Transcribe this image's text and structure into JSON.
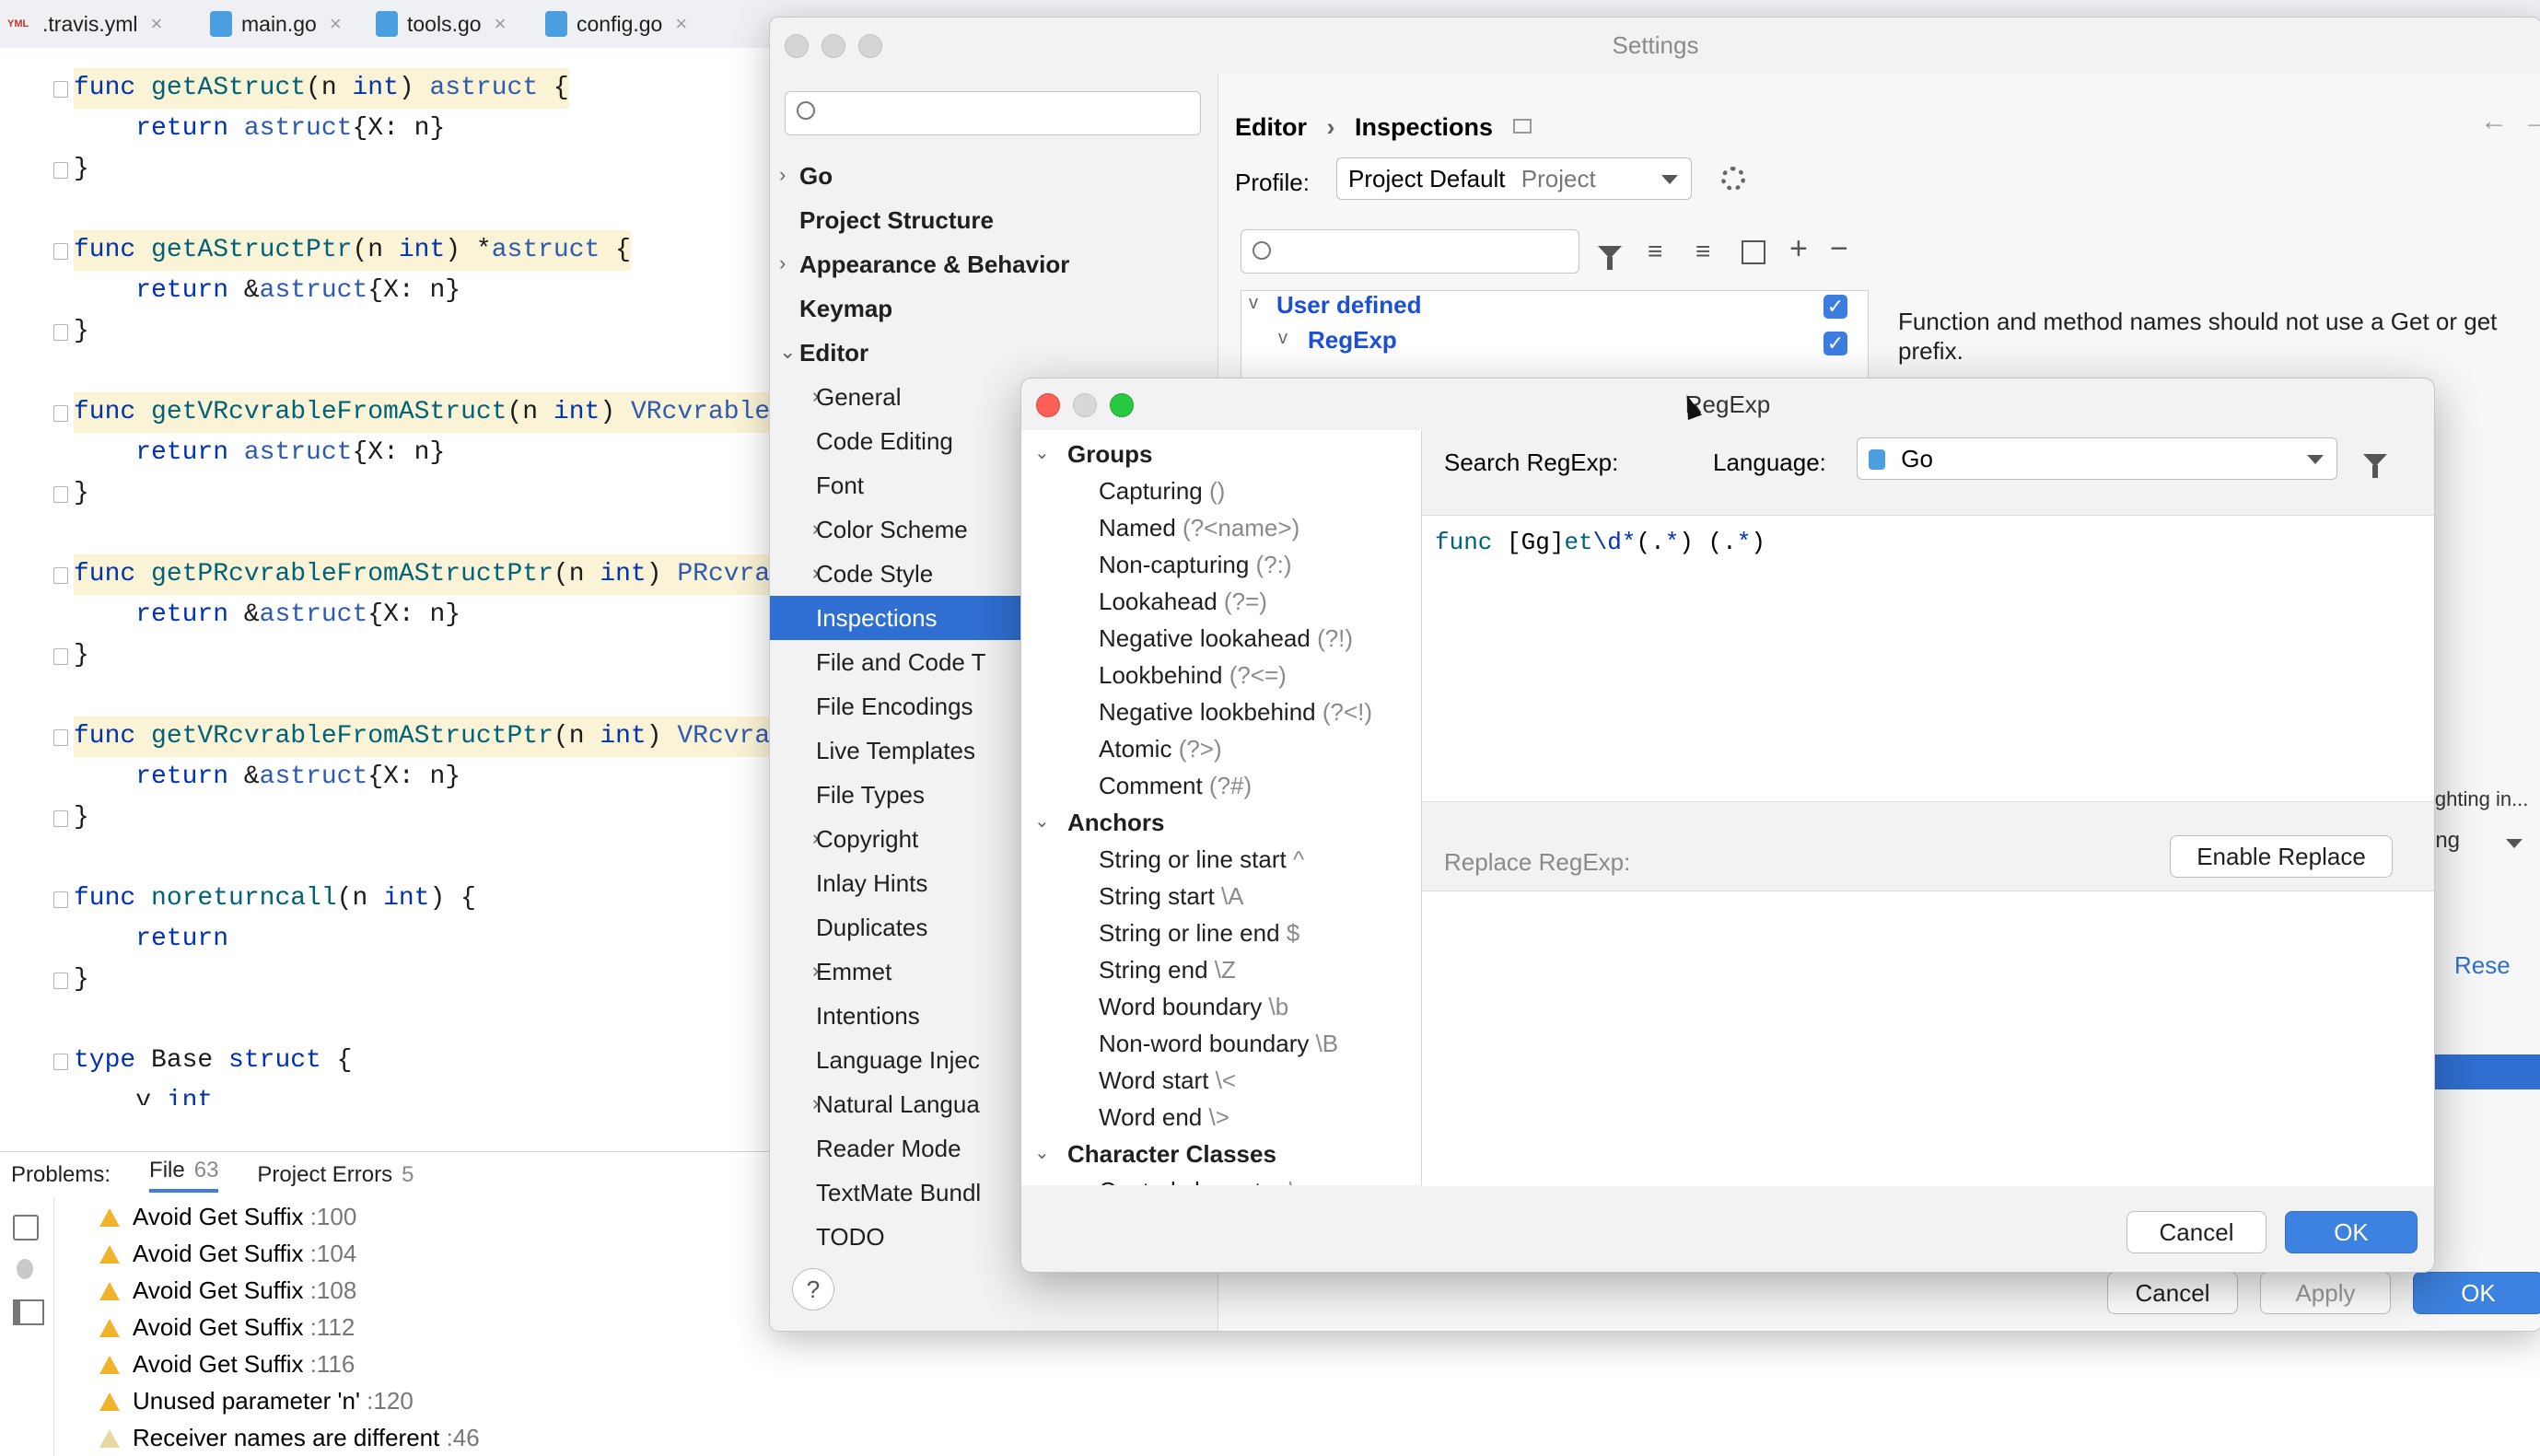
{
  "tabs": [
    {
      "label": ".travis.yml",
      "icon": "yml-file-icon"
    },
    {
      "label": "main.go",
      "icon": "go-file-icon"
    },
    {
      "label": "tools.go",
      "icon": "go-file-icon"
    },
    {
      "label": "config.go",
      "icon": "go-file-icon"
    }
  ],
  "editor": {
    "lines": [
      {
        "parts": [
          [
            "kw",
            "func "
          ],
          [
            "fn",
            "getAStruct"
          ],
          [
            "",
            "(n "
          ],
          [
            "kw",
            "int"
          ],
          [
            "",
            ") "
          ],
          [
            "ty",
            "astruct"
          ],
          [
            "",
            " {"
          ]
        ],
        "hl": true
      },
      {
        "parts": [
          [
            "",
            "    "
          ],
          [
            "kw",
            "return "
          ],
          [
            "ty",
            "astruct"
          ],
          [
            "",
            "{X: n}"
          ]
        ],
        "hl": false
      },
      {
        "parts": [
          [
            "",
            "}"
          ]
        ],
        "hl": false
      },
      {
        "parts": [
          [
            "",
            ""
          ]
        ],
        "hl": false
      },
      {
        "parts": [
          [
            "kw",
            "func "
          ],
          [
            "fn",
            "getAStructPtr"
          ],
          [
            "",
            "(n "
          ],
          [
            "kw",
            "int"
          ],
          [
            "",
            ") *"
          ],
          [
            "ty",
            "astruct"
          ],
          [
            "",
            " {"
          ]
        ],
        "hl": true
      },
      {
        "parts": [
          [
            "",
            "    "
          ],
          [
            "kw",
            "return "
          ],
          [
            "",
            "&"
          ],
          [
            "ty",
            "astruct"
          ],
          [
            "",
            "{X: n}"
          ]
        ],
        "hl": false
      },
      {
        "parts": [
          [
            "",
            "}"
          ]
        ],
        "hl": false
      },
      {
        "parts": [
          [
            "",
            ""
          ]
        ],
        "hl": false
      },
      {
        "parts": [
          [
            "kw",
            "func "
          ],
          [
            "fn",
            "getVRcvrableFromAStruct"
          ],
          [
            "",
            "(n "
          ],
          [
            "kw",
            "int"
          ],
          [
            "",
            ") "
          ],
          [
            "ty",
            "VRcvrable"
          ],
          [
            "",
            " {"
          ]
        ],
        "hl": true
      },
      {
        "parts": [
          [
            "",
            "    "
          ],
          [
            "kw",
            "return "
          ],
          [
            "ty",
            "astruct"
          ],
          [
            "",
            "{X: n}"
          ]
        ],
        "hl": false
      },
      {
        "parts": [
          [
            "",
            "}"
          ]
        ],
        "hl": false
      },
      {
        "parts": [
          [
            "",
            ""
          ]
        ],
        "hl": false
      },
      {
        "parts": [
          [
            "kw",
            "func "
          ],
          [
            "fn",
            "getPRcvrableFromAStructPtr"
          ],
          [
            "",
            "(n "
          ],
          [
            "kw",
            "int"
          ],
          [
            "",
            ") "
          ],
          [
            "ty",
            "PRcvrabl"
          ]
        ],
        "hl": true
      },
      {
        "parts": [
          [
            "",
            "    "
          ],
          [
            "kw",
            "return "
          ],
          [
            "",
            "&"
          ],
          [
            "ty",
            "astruct"
          ],
          [
            "",
            "{X: n}"
          ]
        ],
        "hl": false
      },
      {
        "parts": [
          [
            "",
            "}"
          ]
        ],
        "hl": false
      },
      {
        "parts": [
          [
            "",
            ""
          ]
        ],
        "hl": false
      },
      {
        "parts": [
          [
            "kw",
            "func "
          ],
          [
            "fn",
            "getVRcvrableFromAStructPtr"
          ],
          [
            "",
            "(n "
          ],
          [
            "kw",
            "int"
          ],
          [
            "",
            ") "
          ],
          [
            "ty",
            "VRcvrabl"
          ]
        ],
        "hl": true
      },
      {
        "parts": [
          [
            "",
            "    "
          ],
          [
            "kw",
            "return "
          ],
          [
            "",
            "&"
          ],
          [
            "ty",
            "astruct"
          ],
          [
            "",
            "{X: n}"
          ]
        ],
        "hl": false
      },
      {
        "parts": [
          [
            "",
            "}"
          ]
        ],
        "hl": false
      },
      {
        "parts": [
          [
            "",
            ""
          ]
        ],
        "hl": false
      },
      {
        "parts": [
          [
            "kw",
            "func "
          ],
          [
            "fn",
            "noreturncall"
          ],
          [
            "",
            "(n "
          ],
          [
            "kw",
            "int"
          ],
          [
            "",
            ") {"
          ]
        ],
        "hl": false
      },
      {
        "parts": [
          [
            "",
            "    "
          ],
          [
            "kw",
            "return"
          ]
        ],
        "hl": false
      },
      {
        "parts": [
          [
            "",
            "}"
          ]
        ],
        "hl": false
      },
      {
        "parts": [
          [
            "",
            ""
          ]
        ],
        "hl": false
      },
      {
        "parts": [
          [
            "kw",
            "type "
          ],
          [
            "",
            "Base "
          ],
          [
            "kw",
            "struct"
          ],
          [
            "",
            " {"
          ]
        ],
        "hl": false
      },
      {
        "parts": [
          [
            "",
            "    y "
          ],
          [
            "kw",
            "int"
          ]
        ],
        "hl": false
      }
    ]
  },
  "problems": {
    "label": "Problems:",
    "tabs": [
      {
        "label": "File",
        "count": "63",
        "active": true
      },
      {
        "label": "Project Errors",
        "count": "5",
        "active": false
      }
    ],
    "items": [
      {
        "text": "Avoid Get Suffix",
        "loc": ":100",
        "level": "warn"
      },
      {
        "text": "Avoid Get Suffix",
        "loc": ":104",
        "level": "warn"
      },
      {
        "text": "Avoid Get Suffix",
        "loc": ":108",
        "level": "warn"
      },
      {
        "text": "Avoid Get Suffix",
        "loc": ":112",
        "level": "warn"
      },
      {
        "text": "Avoid Get Suffix",
        "loc": ":116",
        "level": "warn"
      },
      {
        "text": "Unused parameter 'n'",
        "loc": ":120",
        "level": "warn"
      },
      {
        "text": "Receiver names are different",
        "loc": ":46",
        "level": "weak"
      }
    ]
  },
  "settings": {
    "title": "Settings",
    "breadcrumb": {
      "parent": "Editor",
      "current": "Inspections"
    },
    "profile_label": "Profile:",
    "profile_value": "Project Default",
    "profile_scope": "Project",
    "nav": [
      {
        "label": "Go",
        "bold": true,
        "level": 0,
        "chev": ">"
      },
      {
        "label": "Project Structure",
        "bold": true,
        "level": 0,
        "chev": ""
      },
      {
        "label": "Appearance & Behavior",
        "bold": true,
        "level": 0,
        "chev": ">"
      },
      {
        "label": "Keymap",
        "bold": true,
        "level": 0,
        "chev": ""
      },
      {
        "label": "Editor",
        "bold": true,
        "level": 0,
        "chev": "v"
      },
      {
        "label": "General",
        "bold": false,
        "level": 1,
        "chev": ">"
      },
      {
        "label": "Code Editing",
        "bold": false,
        "level": 1,
        "chev": ""
      },
      {
        "label": "Font",
        "bold": false,
        "level": 1,
        "chev": ""
      },
      {
        "label": "Color Scheme",
        "bold": false,
        "level": 1,
        "chev": ">"
      },
      {
        "label": "Code Style",
        "bold": false,
        "level": 1,
        "chev": ">"
      },
      {
        "label": "Inspections",
        "bold": false,
        "level": 1,
        "chev": "",
        "selected": true
      },
      {
        "label": "File and Code T",
        "bold": false,
        "level": 1,
        "chev": ""
      },
      {
        "label": "File Encodings",
        "bold": false,
        "level": 1,
        "chev": ""
      },
      {
        "label": "Live Templates",
        "bold": false,
        "level": 1,
        "chev": ""
      },
      {
        "label": "File Types",
        "bold": false,
        "level": 1,
        "chev": ""
      },
      {
        "label": "Copyright",
        "bold": false,
        "level": 1,
        "chev": ">"
      },
      {
        "label": "Inlay Hints",
        "bold": false,
        "level": 1,
        "chev": ""
      },
      {
        "label": "Duplicates",
        "bold": false,
        "level": 1,
        "chev": ""
      },
      {
        "label": "Emmet",
        "bold": false,
        "level": 1,
        "chev": ">"
      },
      {
        "label": "Intentions",
        "bold": false,
        "level": 1,
        "chev": ""
      },
      {
        "label": "Language Injec",
        "bold": false,
        "level": 1,
        "chev": ""
      },
      {
        "label": "Natural Langua",
        "bold": false,
        "level": 1,
        "chev": ">"
      },
      {
        "label": "Reader Mode",
        "bold": false,
        "level": 1,
        "chev": ""
      },
      {
        "label": "TextMate Bundl",
        "bold": false,
        "level": 1,
        "chev": ""
      },
      {
        "label": "TODO",
        "bold": false,
        "level": 1,
        "chev": ""
      }
    ],
    "tree": {
      "root": "User defined",
      "child": "RegExp"
    },
    "description": "Function and method names should not use a Get or get prefix.",
    "right_partial": {
      "highlight": "ighting in...",
      "dropdown": "ing",
      "reset": "Rese"
    },
    "buttons": {
      "cancel": "Cancel",
      "apply": "Apply",
      "ok": "OK"
    },
    "help": "?"
  },
  "regexp_dialog": {
    "title": "RegExp",
    "search_label": "Search RegExp:",
    "language_label": "Language:",
    "language_value": "Go",
    "regex_parts": [
      [
        "fn",
        "func "
      ],
      [
        "",
        "[Gg]"
      ],
      [
        "fn",
        "et"
      ],
      [
        "kw",
        "\\d*"
      ],
      [
        "",
        "(."
      ],
      [
        "kw",
        "*"
      ],
      [
        "",
        ") (."
      ],
      [
        "kw",
        "*"
      ],
      [
        "",
        ")"
      ]
    ],
    "replace_label": "Replace RegExp:",
    "enable_replace": "Enable Replace",
    "cancel": "Cancel",
    "ok": "OK",
    "groups": [
      {
        "type": "group",
        "label": "Groups"
      },
      {
        "type": "item",
        "label": "Capturing",
        "syntax": "()"
      },
      {
        "type": "item",
        "label": "Named",
        "syntax": "(?<name>)"
      },
      {
        "type": "item",
        "label": "Non-capturing",
        "syntax": "(?:)"
      },
      {
        "type": "item",
        "label": "Lookahead",
        "syntax": "(?=)"
      },
      {
        "type": "item",
        "label": "Negative lookahead",
        "syntax": "(?!)"
      },
      {
        "type": "item",
        "label": "Lookbehind",
        "syntax": "(?<=)"
      },
      {
        "type": "item",
        "label": "Negative lookbehind",
        "syntax": "(?<!)"
      },
      {
        "type": "item",
        "label": "Atomic",
        "syntax": "(?>)"
      },
      {
        "type": "item",
        "label": "Comment",
        "syntax": "(?#)"
      },
      {
        "type": "group",
        "label": "Anchors"
      },
      {
        "type": "item",
        "label": "String or line start",
        "syntax": "^"
      },
      {
        "type": "item",
        "label": "String start",
        "syntax": "\\A"
      },
      {
        "type": "item",
        "label": "String or line end",
        "syntax": "$"
      },
      {
        "type": "item",
        "label": "String end",
        "syntax": "\\Z"
      },
      {
        "type": "item",
        "label": "Word boundary",
        "syntax": "\\b"
      },
      {
        "type": "item",
        "label": "Non-word boundary",
        "syntax": "\\B"
      },
      {
        "type": "item",
        "label": "Word start",
        "syntax": "\\<"
      },
      {
        "type": "item",
        "label": "Word end",
        "syntax": "\\>"
      },
      {
        "type": "group",
        "label": "Character Classes"
      },
      {
        "type": "item",
        "label": "Control character",
        "syntax": "\\c"
      }
    ]
  },
  "colors": {
    "accent": "#2f6fd1",
    "warning": "#f0b32b",
    "highlight_line": "#fbf3d5"
  }
}
